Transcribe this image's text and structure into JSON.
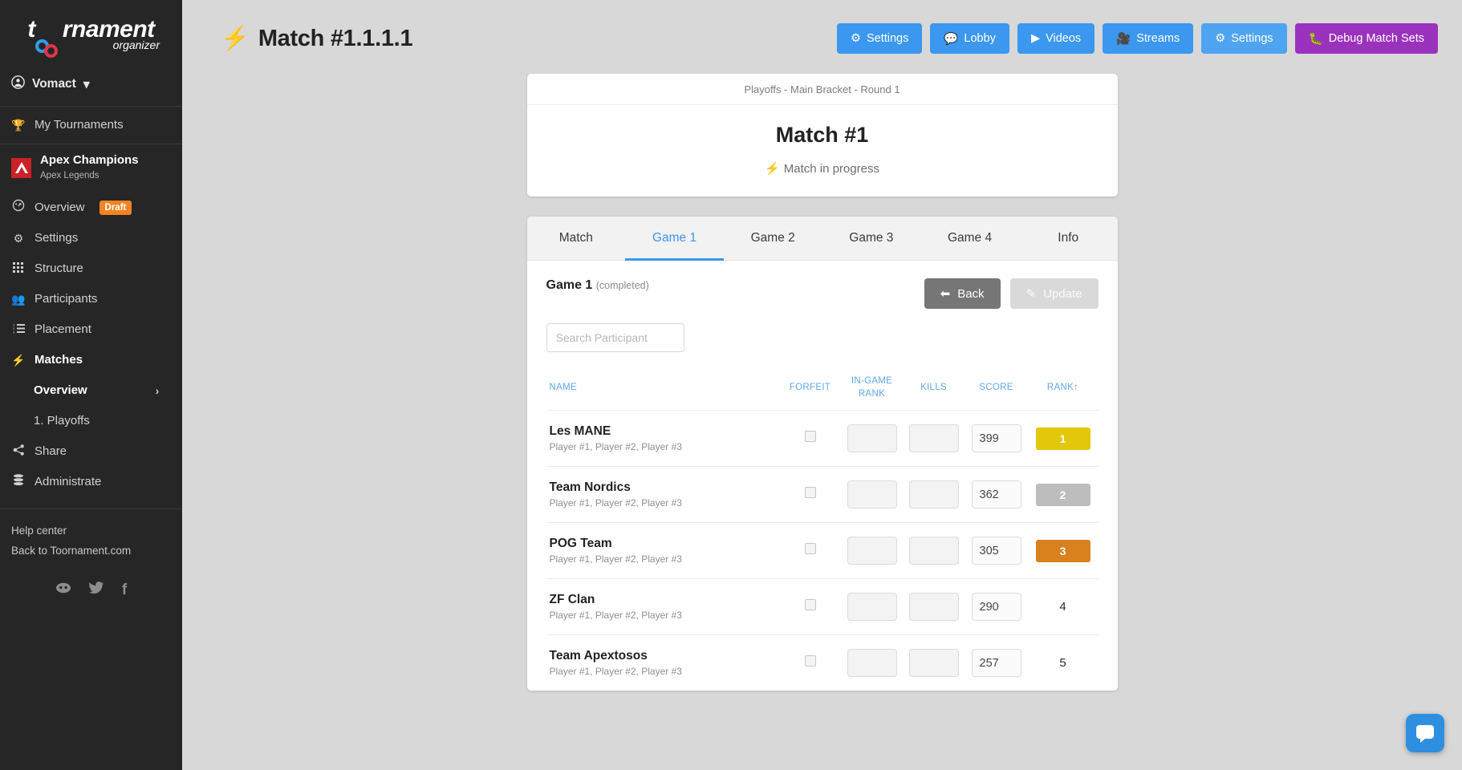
{
  "sidebar": {
    "logo": {
      "text_before": "t",
      "text_after": "rnament",
      "subtitle": "organizer"
    },
    "user": {
      "name": "Vomact",
      "icon": "user-circle-icon",
      "caret": "chevron-down-icon"
    },
    "my_tournaments": {
      "label": "My Tournaments",
      "icon": "trophy-icon"
    },
    "tournament": {
      "name": "Apex Champions",
      "game": "Apex Legends",
      "logo": "apex-legends-logo"
    },
    "nav": [
      {
        "label": "Overview",
        "icon": "dashboard-icon",
        "badge": "Draft"
      },
      {
        "label": "Settings",
        "icon": "gears-icon"
      },
      {
        "label": "Structure",
        "icon": "grid-icon"
      },
      {
        "label": "Participants",
        "icon": "people-icon"
      },
      {
        "label": "Placement",
        "icon": "ordered-list-icon"
      },
      {
        "label": "Matches",
        "icon": "bolt-icon"
      }
    ],
    "sub_nav": [
      {
        "label": "Overview",
        "chevron": "chevron-right-icon",
        "active": true
      },
      {
        "label": "1. Playoffs",
        "active": false
      }
    ],
    "nav_after": [
      {
        "label": "Share",
        "icon": "share-icon"
      },
      {
        "label": "Administrate",
        "icon": "database-icon"
      }
    ],
    "footer_links": [
      {
        "label": "Help center"
      },
      {
        "label": "Back to Toornament.com"
      }
    ],
    "socials": [
      {
        "name": "discord-icon",
        "glyph": "🎮"
      },
      {
        "name": "twitter-icon",
        "glyph": "✉"
      },
      {
        "name": "facebook-icon",
        "glyph": "f"
      }
    ]
  },
  "header": {
    "title": "Match #1.1.1.1",
    "title_icon": "bolt-icon",
    "buttons": [
      {
        "label": "Settings",
        "icon": "gears-icon",
        "style": "blue"
      },
      {
        "label": "Lobby",
        "icon": "chat-icon",
        "style": "blue"
      },
      {
        "label": "Videos",
        "icon": "play-circle-icon",
        "style": "blue"
      },
      {
        "label": "Streams",
        "icon": "video-camera-icon",
        "style": "blue"
      },
      {
        "label": "Settings",
        "icon": "gears-icon",
        "style": "blue-light"
      },
      {
        "label": "Debug Match Sets",
        "icon": "bug-icon",
        "style": "purple"
      }
    ]
  },
  "match_card": {
    "breadcrumb": "Playoffs - Main Bracket - Round 1",
    "title": "Match #1",
    "status": "Match in progress",
    "status_icon": "bolt-icon"
  },
  "tabs": [
    {
      "label": "Match",
      "active": false
    },
    {
      "label": "Game 1",
      "active": true
    },
    {
      "label": "Game 2",
      "active": false
    },
    {
      "label": "Game 3",
      "active": false
    },
    {
      "label": "Game 4",
      "active": false
    },
    {
      "label": "Info",
      "active": false
    }
  ],
  "panel": {
    "game_title": "Game 1",
    "game_state": "(completed)",
    "back_label": "Back",
    "back_icon": "arrow-left-icon",
    "update_label": "Update",
    "update_icon": "pencil-icon",
    "search_placeholder": "Search Participant",
    "search_value": ""
  },
  "table": {
    "columns": [
      {
        "key": "name",
        "label": "NAME"
      },
      {
        "key": "forfeit",
        "label": "FORFEIT"
      },
      {
        "key": "ingame_rank",
        "label": "IN-GAME RANK"
      },
      {
        "key": "kills",
        "label": "KILLS"
      },
      {
        "key": "score",
        "label": "SCORE"
      },
      {
        "key": "rank",
        "label": "RANK",
        "sort": "↑"
      }
    ],
    "rows": [
      {
        "name": "Les MANE",
        "players": "Player #1, Player #2, Player #3",
        "forfeit": false,
        "ingame_rank": "",
        "kills": "",
        "score": "399",
        "rank": "1",
        "rank_style": "gold"
      },
      {
        "name": "Team Nordics",
        "players": "Player #1, Player #2, Player #3",
        "forfeit": false,
        "ingame_rank": "",
        "kills": "",
        "score": "362",
        "rank": "2",
        "rank_style": "silver"
      },
      {
        "name": "POG Team",
        "players": "Player #1, Player #2, Player #3",
        "forfeit": false,
        "ingame_rank": "",
        "kills": "",
        "score": "305",
        "rank": "3",
        "rank_style": "bronze"
      },
      {
        "name": "ZF Clan",
        "players": "Player #1, Player #2, Player #3",
        "forfeit": false,
        "ingame_rank": "",
        "kills": "",
        "score": "290",
        "rank": "4",
        "rank_style": "plain"
      },
      {
        "name": "Team Apextosos",
        "players": "Player #1, Player #2, Player #3",
        "forfeit": false,
        "ingame_rank": "",
        "kills": "",
        "score": "257",
        "rank": "5",
        "rank_style": "plain"
      }
    ]
  },
  "colors": {
    "accent_blue": "#3b97ef",
    "purple": "#9b32bd",
    "draft_orange": "#f08422",
    "gold": "#e3c70b",
    "silver": "#bdbdbd",
    "bronze": "#d9811f",
    "sidebar_bg": "#262626"
  },
  "chat_widget": {
    "name": "intercom-chat-button"
  }
}
